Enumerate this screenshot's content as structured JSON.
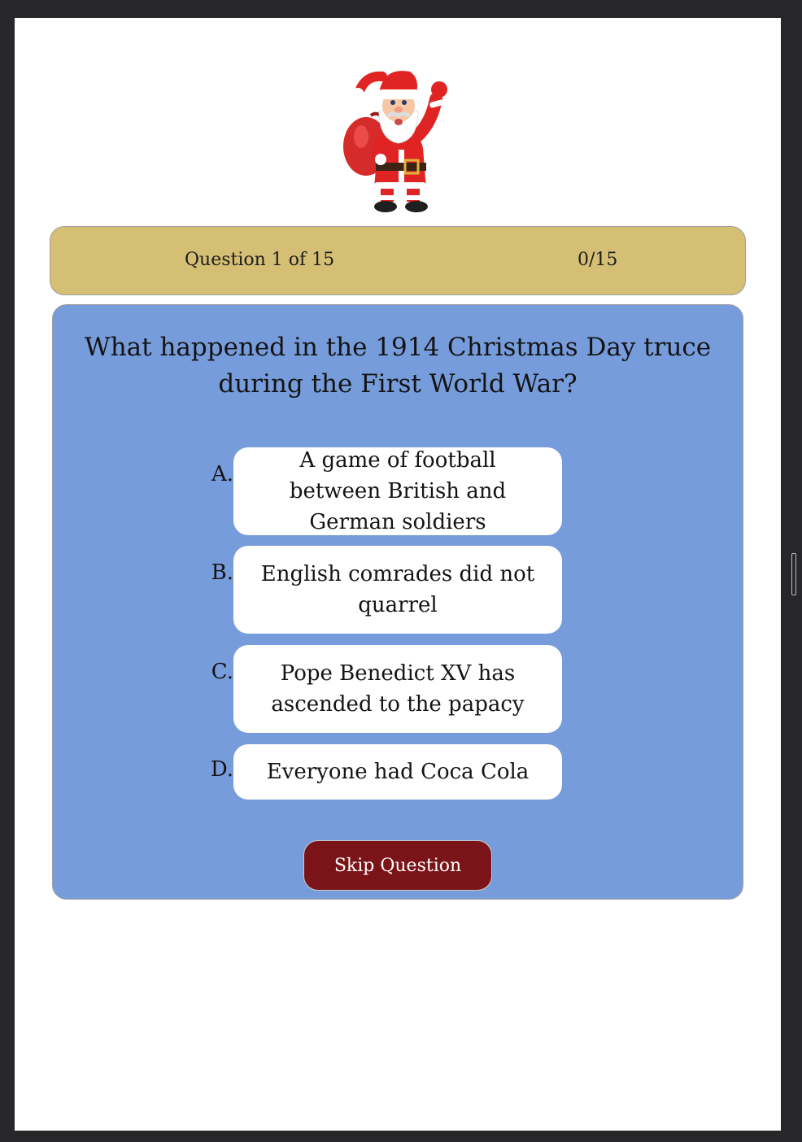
{
  "status": {
    "question_counter": "Question 1 of 15",
    "score": "0/15"
  },
  "quiz": {
    "question": "What happened in the 1914 Christmas Day truce during the First World War?",
    "answers": [
      {
        "letter": "A.",
        "text": "A game of football between British and German soldiers"
      },
      {
        "letter": "B.",
        "text": "English comrades did not quarrel"
      },
      {
        "letter": "C.",
        "text": "Pope Benedict XV has ascended to the papacy"
      },
      {
        "letter": "D.",
        "text": "Everyone had Coca Cola"
      }
    ],
    "skip_label": "Skip Question"
  },
  "images": {
    "mascot": "santa-claus-waving-with-gift-sack"
  },
  "colors": {
    "status_bar": "#d4bf74",
    "quiz_card": "#769cdb",
    "skip_button": "#7a1418",
    "answer_box": "#ffffff"
  }
}
